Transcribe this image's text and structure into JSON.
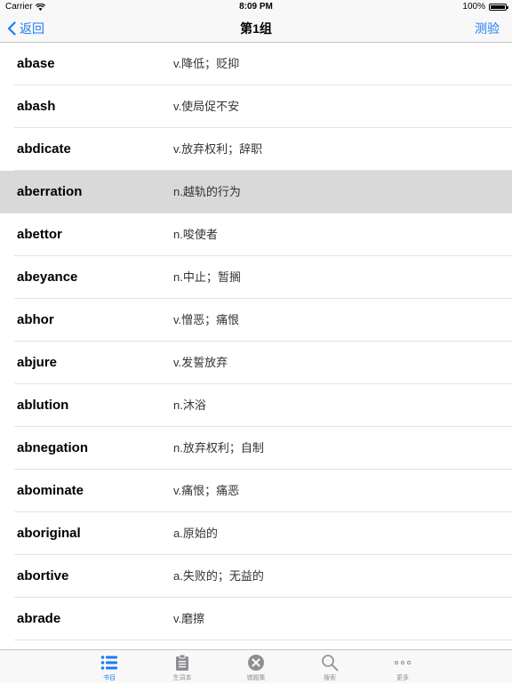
{
  "status_bar": {
    "carrier": "Carrier",
    "time": "8:09 PM",
    "battery": "100%",
    "battery_level": 1.0
  },
  "nav": {
    "back_label": "返回",
    "title": "第1组",
    "quiz_label": "测验"
  },
  "words": [
    {
      "word": "abase",
      "meaning": "v.降低；贬抑"
    },
    {
      "word": "abash",
      "meaning": "v.使局促不安"
    },
    {
      "word": "abdicate",
      "meaning": "v.放弃权利；辞职"
    },
    {
      "word": "aberration",
      "meaning": "n.越轨的行为",
      "selected": true
    },
    {
      "word": "abettor",
      "meaning": "n.唆使者"
    },
    {
      "word": "abeyance",
      "meaning": "n.中止；暂搁"
    },
    {
      "word": "abhor",
      "meaning": "v.憎恶；痛恨"
    },
    {
      "word": "abjure",
      "meaning": "v.发誓放弃"
    },
    {
      "word": "ablution",
      "meaning": "n.沐浴"
    },
    {
      "word": "abnegation",
      "meaning": "n.放弃权利；自制"
    },
    {
      "word": "abominate",
      "meaning": "v.痛恨；痛恶"
    },
    {
      "word": "aboriginal",
      "meaning": "a.原始的"
    },
    {
      "word": "abortive",
      "meaning": "a.失败的；无益的"
    },
    {
      "word": "abrade",
      "meaning": "v.磨擦"
    }
  ],
  "tabs": [
    {
      "label": "书目",
      "icon": "list-icon",
      "active": true
    },
    {
      "label": "生词本",
      "icon": "clipboard-icon"
    },
    {
      "label": "错题集",
      "icon": "close-circle-icon"
    },
    {
      "label": "搜索",
      "icon": "search-icon"
    },
    {
      "label": "更多",
      "icon": "more-icon"
    }
  ],
  "colors": {
    "accent": "#1a7cf3",
    "selected_row": "#d9d9d9",
    "inactive_tab": "#8e8e93"
  }
}
